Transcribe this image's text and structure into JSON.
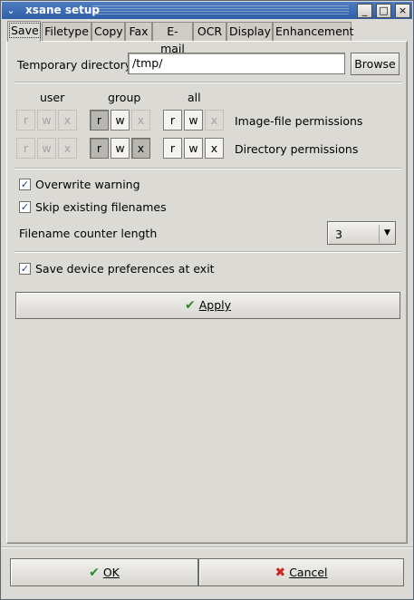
{
  "window": {
    "title": "xsane setup",
    "menu_icon": "chevron-down-icon",
    "controls": [
      "_",
      "□",
      "×"
    ]
  },
  "tabs": [
    "Save",
    "Filetype",
    "Copy",
    "Fax",
    "E-mail",
    "OCR",
    "Display",
    "Enhancement"
  ],
  "save": {
    "temp_dir_label": "Temporary directory",
    "temp_dir_value": "/tmp/",
    "browse_label": "Browse",
    "perm_headers": {
      "user": "user",
      "group": "group",
      "all": "all"
    },
    "perm_bits": [
      "r",
      "w",
      "x"
    ],
    "image_perm_label": "Image-file permissions",
    "dir_perm_label": "Directory permissions",
    "overwrite_warning": "Overwrite warning",
    "skip_existing": "Skip existing filenames",
    "counter_label": "Filename counter length",
    "counter_value": "3",
    "save_prefs": "Save device preferences at exit",
    "apply_label": "Apply"
  },
  "footer": {
    "ok_label": "OK",
    "cancel_label": "Cancel"
  },
  "colors": {
    "titlebar": "#2f5fa8",
    "window_bg": "#dcdad5",
    "apply_icon": "#2a8a2a",
    "cancel_icon": "#c8281e"
  }
}
